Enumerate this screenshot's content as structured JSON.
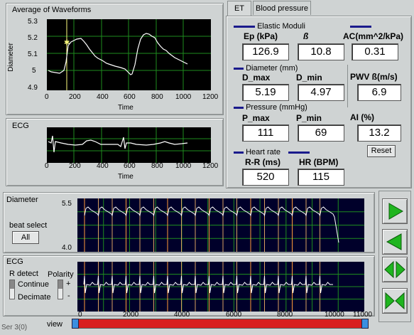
{
  "waveforms": {
    "title": "Average of Waveforms",
    "ylabel": "Diameter",
    "xlabel": "Time",
    "yticks": [
      "5.3",
      "5.2",
      "5.1",
      "5",
      "4.9"
    ],
    "xticks": [
      "0",
      "200",
      "400",
      "600",
      "800",
      "1000",
      "1200"
    ]
  },
  "ecg_top": {
    "title": "ECG",
    "xlabel": "Time",
    "xticks": [
      "0",
      "200",
      "400",
      "600",
      "800",
      "1000",
      "1200"
    ]
  },
  "tabs": {
    "et": "ET",
    "bp": "Blood pressure"
  },
  "elastic": {
    "title": "Elastic Moduli",
    "ep_label": "Ep (kPa)",
    "ep_value": "126.9",
    "beta_label": "ß",
    "beta_value": "10.8",
    "ac_label": "AC(mm^2/kPa)",
    "ac_value": "0.31"
  },
  "diameter": {
    "title": "Diameter (mm)",
    "dmax_label": "D_max",
    "dmax_value": "5.19",
    "dmin_label": "D_min",
    "dmin_value": "4.97"
  },
  "pwv": {
    "label": "PWV ß(m/s)",
    "value": "6.9"
  },
  "pressure": {
    "title": "Pressure (mmHg)",
    "pmax_label": "P_max",
    "pmax_value": "111",
    "pmin_label": "P_min",
    "pmin_value": "69"
  },
  "ai": {
    "label": "AI (%)",
    "value": "13.2"
  },
  "reset_label": "Reset",
  "heartrate": {
    "title": "Heart rate",
    "rr_label": "R-R (ms)",
    "rr_value": "520",
    "hr_label": "HR (BPM)",
    "hr_value": "115"
  },
  "diameter_strip": {
    "label": "Diameter",
    "ytop": "5.5",
    "ybottom": "4.0",
    "beat_select": "beat select",
    "all_button": "All"
  },
  "ecg_strip": {
    "label": "ECG",
    "r_detect": "R detect",
    "continue": "Continue",
    "decimate": "Decimate",
    "polarity": "Polarity",
    "plus": "+",
    "minus": "-",
    "xticks": [
      "0",
      "2000",
      "4000",
      "6000",
      "8000",
      "10000",
      "11000"
    ]
  },
  "view_label": "view",
  "status_text": "Ser 3(0)",
  "colors": {
    "green_arrow": "#1fb51f",
    "scroll_red": "#d81e1e",
    "trace": "#ffffff",
    "grid": "#1e8c1e"
  }
}
